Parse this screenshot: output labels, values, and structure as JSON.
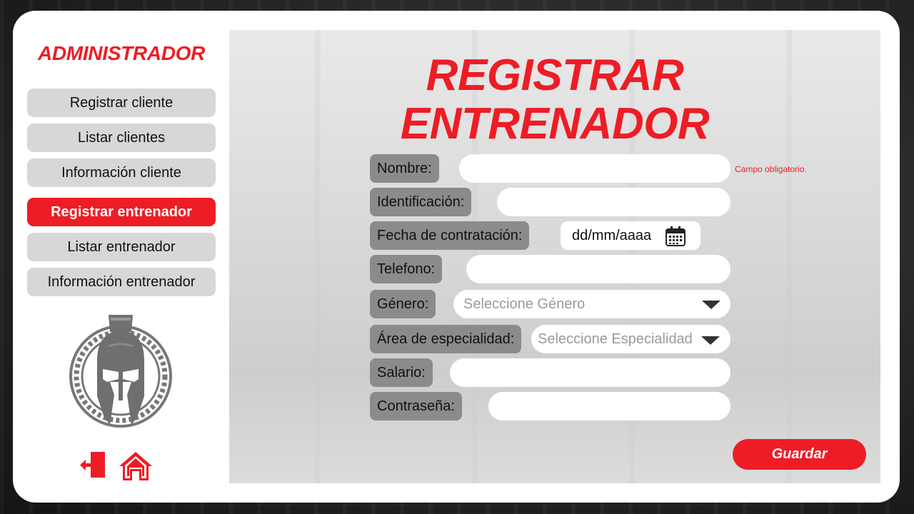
{
  "sidebar": {
    "title": "ADMINISTRADOR",
    "items": [
      {
        "label": "Registrar cliente"
      },
      {
        "label": "Listar clientes"
      },
      {
        "label": "Información cliente"
      },
      {
        "label": "Registrar entrenador",
        "active": true
      },
      {
        "label": "Listar entrenador"
      },
      {
        "label": "Información entrenador"
      }
    ],
    "footer_icons": [
      "logout-icon",
      "home-icon"
    ],
    "logo": "spartan-helmet-logo"
  },
  "form": {
    "title_line1": "REGISTRAR",
    "title_line2": "ENTRENADOR",
    "nombre_label": "Nombre:",
    "nombre_value": "",
    "nombre_error": "Campo obligatorio.",
    "identificacion_label": "Identificación:",
    "identificacion_value": "",
    "fecha_label": "Fecha de contratación:",
    "fecha_placeholder": "dd/mm/aaaa",
    "telefono_label": "Telefono:",
    "telefono_value": "",
    "genero_label": "Género:",
    "genero_placeholder": "Seleccione Género",
    "especialidad_label": "Área de especialidad:",
    "especialidad_placeholder": "Seleccione Especialidad",
    "salario_label": "Salario:",
    "salario_value": "",
    "contrasena_label": "Contraseña:",
    "contrasena_value": "",
    "save_label": "Guardar"
  },
  "colors": {
    "accent": "#ee1c25",
    "label_bg": "#8b8b8b",
    "nav_bg": "#d7d7d7"
  }
}
